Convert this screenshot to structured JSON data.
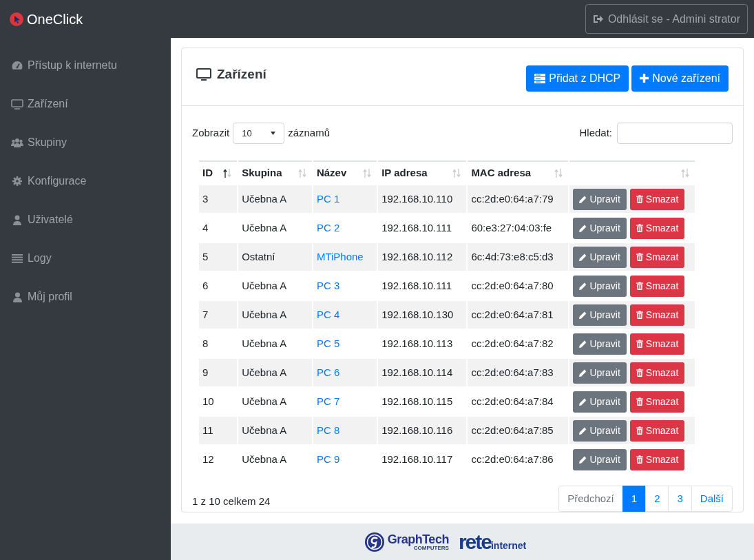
{
  "brand": "OneClick",
  "logout_button": "Odhlásit se - Admini strator",
  "sidebar": {
    "items": [
      {
        "label": "Přístup k internetu"
      },
      {
        "label": "Zařízení"
      },
      {
        "label": "Skupiny"
      },
      {
        "label": "Konfigurace"
      },
      {
        "label": "Uživatelé"
      },
      {
        "label": "Logy"
      },
      {
        "label": "Můj profil"
      }
    ]
  },
  "card": {
    "title": "Zařízení",
    "buttons": [
      {
        "label": "Přidat z DHCP"
      },
      {
        "label": "Nové zařízení"
      }
    ],
    "length": {
      "before": "Zobrazit",
      "value": "10",
      "after": "záznamů"
    },
    "search": {
      "label": "Hledat:"
    },
    "table": {
      "columns": [
        {
          "label": "ID",
          "sorted_ascending": true
        },
        {
          "label": "Skupina",
          "sorted_ascending": false
        },
        {
          "label": "Název",
          "sorted_ascending": false
        },
        {
          "label": "IP adresa",
          "sorted_ascending": false
        },
        {
          "label": "MAC adresa",
          "sorted_ascending": false
        },
        {
          "sorted_ascending": false
        }
      ],
      "rows": [
        {
          "id": "3",
          "group": "Učebna A",
          "name": "PC 1",
          "ip": "192.168.10.110",
          "mac": "cc:2d:e0:64:a7:79",
          "edit": "Upravit",
          "delete": "Smazat"
        },
        {
          "id": "4",
          "group": "Učebna A",
          "name": "PC 2",
          "ip": "192.168.10.111",
          "mac": "60:e3:27:04:03:fe",
          "edit": "Upravit",
          "delete": "Smazat"
        },
        {
          "id": "5",
          "group": "Ostatní",
          "name": "MTiPhone",
          "ip": "192.168.10.112",
          "mac": "6c:4d:73:e8:c5:d3",
          "edit": "Upravit",
          "delete": "Smazat"
        },
        {
          "id": "6",
          "group": "Učebna A",
          "name": "PC 3",
          "ip": "192.168.10.111",
          "mac": "cc:2d:e0:64:a7:80",
          "edit": "Upravit",
          "delete": "Smazat"
        },
        {
          "id": "7",
          "group": "Učebna A",
          "name": "PC 4",
          "ip": "192.168.10.130",
          "mac": "cc:2d:e0:64:a7:81",
          "edit": "Upravit",
          "delete": "Smazat"
        },
        {
          "id": "8",
          "group": "Učebna A",
          "name": "PC 5",
          "ip": "192.168.10.113",
          "mac": "cc:2d:e0:64:a7:82",
          "edit": "Upravit",
          "delete": "Smazat"
        },
        {
          "id": "9",
          "group": "Učebna A",
          "name": "PC 6",
          "ip": "192.168.10.114",
          "mac": "cc:2d:e0:64:a7:83",
          "edit": "Upravit",
          "delete": "Smazat"
        },
        {
          "id": "10",
          "group": "Učebna A",
          "name": "PC 7",
          "ip": "192.168.10.115",
          "mac": "cc:2d:e0:64:a7:84",
          "edit": "Upravit",
          "delete": "Smazat"
        },
        {
          "id": "11",
          "group": "Učebna A",
          "name": "PC 8",
          "ip": "192.168.10.116",
          "mac": "cc:2d:e0:64:a7:85",
          "edit": "Upravit",
          "delete": "Smazat"
        },
        {
          "id": "12",
          "group": "Učebna A",
          "name": "PC 9",
          "ip": "192.168.10.117",
          "mac": "cc:2d:e0:64:a7:86",
          "edit": "Upravit",
          "delete": "Smazat"
        }
      ]
    },
    "info": "1 z 10 celkem 24",
    "pagination": [
      {
        "label": "Předchozí",
        "kind": "prev",
        "selected": false
      },
      {
        "label": "1",
        "kind": "page",
        "selected": true
      },
      {
        "label": "2",
        "kind": "page",
        "selected": false
      },
      {
        "label": "3",
        "kind": "page",
        "selected": false
      },
      {
        "label": "Další",
        "kind": "next",
        "selected": false
      }
    ]
  },
  "footer": {
    "logos": [
      {
        "kind": "graphtech",
        "name": "GraphTech",
        "sub": "COMPUTERS"
      },
      {
        "kind": "rete",
        "name": "rete",
        "sub": "internet"
      }
    ]
  }
}
